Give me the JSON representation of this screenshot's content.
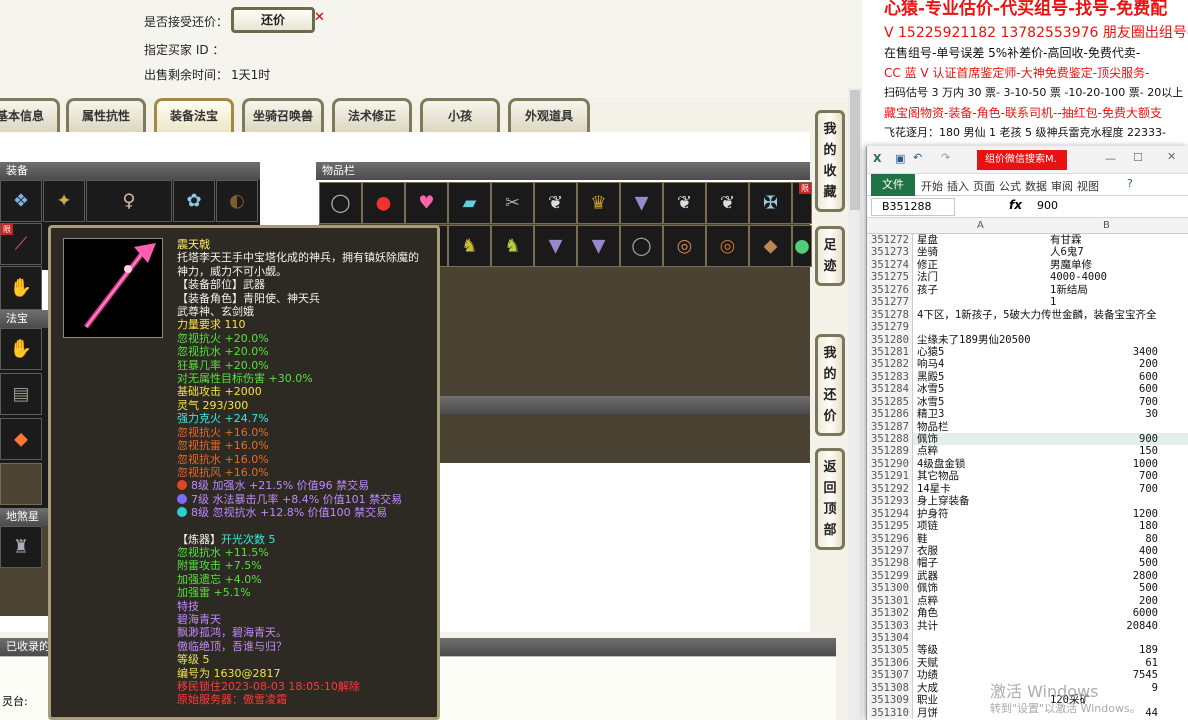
{
  "trade": {
    "accept_label": "是否接受还价：",
    "haggle_button": "还价",
    "buyer_label": "指定买家 ID ：",
    "remaining_label": "出售剩余时间：",
    "remaining_value": "1天1时"
  },
  "tabs": [
    "基本信息",
    "属性抗性",
    "装备法宝",
    "坐骑召唤兽",
    "法术修正",
    "小孩",
    "外观道具"
  ],
  "sections": {
    "equip": "装备",
    "inventory": "物品栏",
    "fabao": "法宝",
    "dishaxing": "地煞星斯",
    "collected": "已收录的",
    "lingtai": "灵台:"
  },
  "side_buttons": [
    "我的收藏",
    "足迹",
    "我的还价",
    "返回顶部"
  ],
  "tooltip": {
    "name": "震天戟",
    "lines": [
      {
        "t": "托塔李天王手中宝塔化成的神兵，拥有镇妖除魔的",
        "c": "c-white"
      },
      {
        "t": "神力，威力不可小觑。",
        "c": "c-white"
      },
      {
        "t": "【装备部位】武器",
        "c": "c-white"
      },
      {
        "t": "【装备角色】青阳使、神天兵",
        "c": "c-white"
      },
      {
        "t": "武尊神、玄剑娥",
        "c": "c-white"
      },
      {
        "t": "力量要求 110",
        "c": "c-yellow"
      },
      {
        "t": "忽视抗火 +20.0%",
        "c": "c-green"
      },
      {
        "t": "忽视抗水 +20.0%",
        "c": "c-green"
      },
      {
        "t": "狂暴几率 +20.0%",
        "c": "c-green"
      },
      {
        "t": "对无属性目标伤害 +30.0%",
        "c": "c-green"
      },
      {
        "t": "基础攻击 +2000",
        "c": "c-yellow"
      },
      {
        "t": "灵气 293/300",
        "c": "c-yellow"
      },
      {
        "t": "强力克火 +24.7%",
        "c": "c-cyan"
      },
      {
        "t": "忽视抗火 +16.0%",
        "c": "c-orange"
      },
      {
        "t": "忽视抗雷 +16.0%",
        "c": "c-orange"
      },
      {
        "t": "忽视抗水 +16.0%",
        "c": "c-orange"
      },
      {
        "t": "忽视抗风 +16.0%",
        "c": "c-orange"
      }
    ],
    "gems": [
      {
        "t": "8级 加强水 +21.5% 价值96 禁交易",
        "color": "#e0452a",
        "c": "c-purple"
      },
      {
        "t": "7级 水法暴击几率 +8.4% 价值101 禁交易",
        "color": "#7a6cff",
        "c": "c-purple"
      },
      {
        "t": "8级 忽视抗水 +12.8% 价值100 禁交易",
        "color": "#2ad0d0",
        "c": "c-purple"
      }
    ],
    "refine_label": "【炼器】",
    "refine_value": "开光次数 5",
    "refine_lines": [
      {
        "t": "忽视抗水 +11.5%",
        "c": "c-green"
      },
      {
        "t": "附雷攻击 +7.5%",
        "c": "c-green"
      },
      {
        "t": "加强遗忘 +4.0%",
        "c": "c-green"
      },
      {
        "t": "加强雷 +5.1%",
        "c": "c-green"
      }
    ],
    "special_lines": [
      {
        "t": "特技",
        "c": "c-purple"
      },
      {
        "t": "碧海青天",
        "c": "c-purple"
      },
      {
        "t": "飘渺孤鸿，碧海青天。",
        "c": "c-purple"
      },
      {
        "t": "傲临绝顶，吾谁与归？",
        "c": "c-purple"
      }
    ],
    "level": "等级 5",
    "serial": "编号为 1630@2817",
    "transfer": "移民锁住2023-08-03 18:05:10解除",
    "server": "原始服务器：傲雪凌霜"
  },
  "ad": {
    "line1": "心猿-专业估价-代买组号-找号-免费配",
    "line2": "V 15225921182   13782553976 朋友圈出组号-",
    "line3": "在售组号-单号误差 5%补差价-高回收-免费代卖-",
    "line4": "CC 蓝 V 认证首席鉴定师-大神免费鉴定-顶尖服务-",
    "line5": "扫码估号 3 万内 30 票- 3-10-50 票  -10-20-100 票- 20以上 150",
    "line6": "藏宝阁物资-装备-角色-联系司机--抽红包-免费大额支",
    "line7": "飞花逐月：180 男仙 1 老孩 5 级神兵雷克水程度 22333-"
  },
  "excel": {
    "title_badge": "组价微信搜索M.",
    "file_tab": "文件",
    "menus": [
      "开始",
      "插入",
      "页面",
      "公式",
      "数据",
      "审阅",
      "视图"
    ],
    "name_box": "B351288",
    "formula_value": "900",
    "col_a": "A",
    "col_b": "B",
    "rows": [
      [
        "351272",
        "星盘",
        "有甘霖",
        ""
      ],
      [
        "351273",
        "坐骑",
        "人6鬼7",
        ""
      ],
      [
        "351274",
        "修正",
        "男魔单修",
        ""
      ],
      [
        "351275",
        "法门",
        "4000-4000",
        ""
      ],
      [
        "351276",
        "孩子",
        "1新结局",
        ""
      ],
      [
        "351277",
        "",
        "1",
        ""
      ],
      [
        "351278",
        "4下区，1新孩子，5破大力传世金麟，装备宝宝齐全",
        "",
        ""
      ],
      [
        "351279",
        "",
        "",
        ""
      ],
      [
        "351280",
        "尘缘未了189男仙20500",
        "",
        ""
      ],
      [
        "351281",
        "心猿5",
        "",
        "3400"
      ],
      [
        "351282",
        "响马4",
        "",
        "200"
      ],
      [
        "351283",
        "黑殿5",
        "",
        "600"
      ],
      [
        "351284",
        "冰雪5",
        "",
        "600"
      ],
      [
        "351285",
        "冰雪5",
        "",
        "700"
      ],
      [
        "351286",
        "精卫3",
        "",
        "30"
      ],
      [
        "351287",
        "物品栏",
        "",
        ""
      ],
      [
        "351288",
        "佩饰",
        "",
        "900"
      ],
      [
        "351289",
        "点粹",
        "",
        "150"
      ],
      [
        "351290",
        "4级盘金锁",
        "",
        "1000"
      ],
      [
        "351291",
        "其它物品",
        "",
        "700"
      ],
      [
        "351292",
        "14星卡",
        "",
        "700"
      ],
      [
        "351293",
        "身上穿装备",
        "",
        ""
      ],
      [
        "351294",
        "护身符",
        "",
        "1200"
      ],
      [
        "351295",
        "项链",
        "",
        "180"
      ],
      [
        "351296",
        "鞋",
        "",
        "80"
      ],
      [
        "351297",
        "衣服",
        "",
        "400"
      ],
      [
        "351298",
        "帽子",
        "",
        "500"
      ],
      [
        "351299",
        "武器",
        "",
        "2800"
      ],
      [
        "351300",
        "佩饰",
        "",
        "500"
      ],
      [
        "351301",
        "点粹",
        "",
        "200"
      ],
      [
        "351302",
        "角色",
        "",
        "6000"
      ],
      [
        "351303",
        "共计",
        "",
        "20840"
      ],
      [
        "351304",
        "",
        "",
        ""
      ],
      [
        "351305",
        "等级",
        "",
        "189"
      ],
      [
        "351306",
        "天赋",
        "",
        "61"
      ],
      [
        "351307",
        "功绩",
        "",
        "7545"
      ],
      [
        "351308",
        "大成",
        "",
        "9"
      ],
      [
        "351309",
        "职业",
        "120采矿",
        ""
      ],
      [
        "351310",
        "月饼",
        "",
        "44"
      ]
    ]
  },
  "watermark": {
    "line1": "激活 Windows",
    "line2": "转到\"设置\"以激活 Windows。"
  }
}
